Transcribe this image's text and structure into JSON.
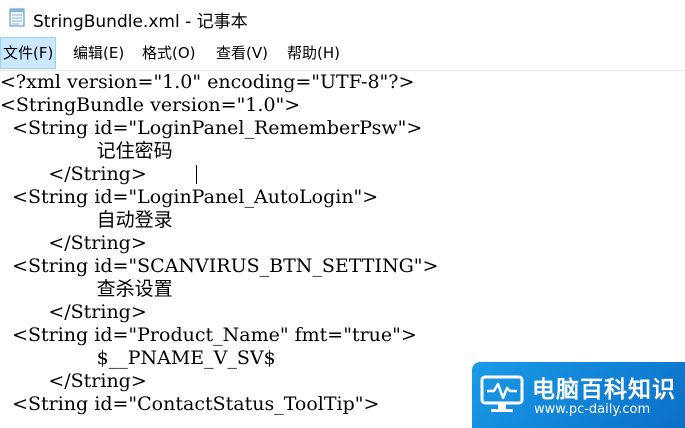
{
  "window": {
    "title": "StringBundle.xml - 记事本"
  },
  "menubar": {
    "items": [
      {
        "label": "文件(F)"
      },
      {
        "label": "编辑(E)"
      },
      {
        "label": "格式(O)"
      },
      {
        "label": "查看(V)"
      },
      {
        "label": "帮助(H)"
      }
    ]
  },
  "editor": {
    "lines": [
      "<?xml version=\"1.0\" encoding=\"UTF-8\"?>",
      "<StringBundle version=\"1.0\">",
      "  <String id=\"LoginPanel_RememberPsw\">",
      "                记住密码",
      "        </String>",
      "  <String id=\"LoginPanel_AutoLogin\">",
      "                自动登录",
      "        </String>",
      "  <String id=\"SCANVIRUS_BTN_SETTING\">",
      "                查杀设置",
      "        </String>",
      "  <String id=\"Product_Name\" fmt=\"true\">",
      "                $__PNAME_V_SV$",
      "        </String>",
      "  <String id=\"ContactStatus_ToolTip\">"
    ]
  },
  "watermark": {
    "title": "电脑百科知识",
    "url": "www.pc-daily.com",
    "brand_color": "#0a7fd6"
  },
  "icons": {
    "app": "notepad-icon",
    "watermark": "monitor-pulse-icon"
  }
}
